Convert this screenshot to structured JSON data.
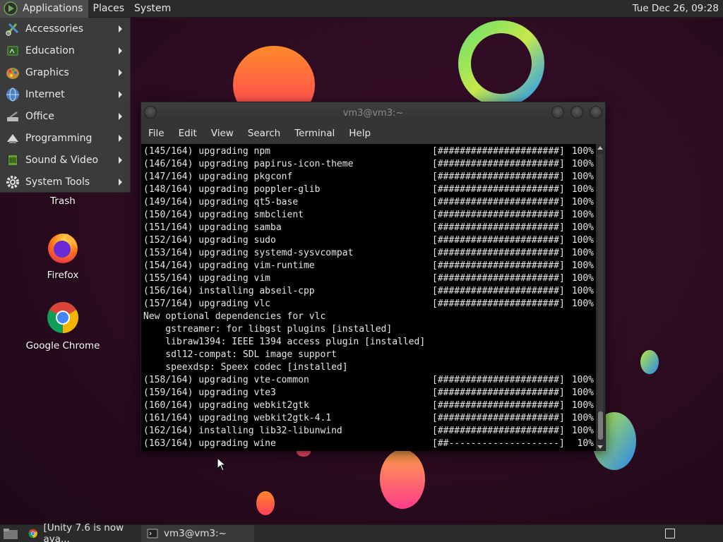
{
  "top_panel": {
    "menus": [
      "Applications",
      "Places",
      "System"
    ],
    "clock": "Tue Dec 26, 09:28"
  },
  "applications_menu": {
    "items": [
      {
        "label": "Accessories",
        "icon": "accessories-icon"
      },
      {
        "label": "Education",
        "icon": "education-icon"
      },
      {
        "label": "Graphics",
        "icon": "graphics-icon"
      },
      {
        "label": "Internet",
        "icon": "internet-icon"
      },
      {
        "label": "Office",
        "icon": "office-icon"
      },
      {
        "label": "Programming",
        "icon": "programming-icon"
      },
      {
        "label": "Sound & Video",
        "icon": "sound-video-icon"
      },
      {
        "label": "System Tools",
        "icon": "system-tools-icon"
      }
    ]
  },
  "desktop_icons": [
    {
      "label": "Trash",
      "icon": "trash-icon"
    },
    {
      "label": "Firefox",
      "icon": "firefox-icon"
    },
    {
      "label": "Google Chrome",
      "icon": "chrome-icon"
    }
  ],
  "terminal": {
    "title": "vm3@vm3:~",
    "menus": [
      "File",
      "Edit",
      "View",
      "Search",
      "Terminal",
      "Help"
    ],
    "lines": [
      {
        "text": "(145/164) upgrading npm",
        "bar": "[######################]",
        "pct": "100%"
      },
      {
        "text": "(146/164) upgrading papirus-icon-theme",
        "bar": "[######################]",
        "pct": "100%"
      },
      {
        "text": "(147/164) upgrading pkgconf",
        "bar": "[######################]",
        "pct": "100%"
      },
      {
        "text": "(148/164) upgrading poppler-glib",
        "bar": "[######################]",
        "pct": "100%"
      },
      {
        "text": "(149/164) upgrading qt5-base",
        "bar": "[######################]",
        "pct": "100%"
      },
      {
        "text": "(150/164) upgrading smbclient",
        "bar": "[######################]",
        "pct": "100%"
      },
      {
        "text": "(151/164) upgrading samba",
        "bar": "[######################]",
        "pct": "100%"
      },
      {
        "text": "(152/164) upgrading sudo",
        "bar": "[######################]",
        "pct": "100%"
      },
      {
        "text": "(153/164) upgrading systemd-sysvcompat",
        "bar": "[######################]",
        "pct": "100%"
      },
      {
        "text": "(154/164) upgrading vim-runtime",
        "bar": "[######################]",
        "pct": "100%"
      },
      {
        "text": "(155/164) upgrading vim",
        "bar": "[######################]",
        "pct": "100%"
      },
      {
        "text": "(156/164) installing abseil-cpp",
        "bar": "[######################]",
        "pct": "100%"
      },
      {
        "text": "(157/164) upgrading vlc",
        "bar": "[######################]",
        "pct": "100%"
      },
      {
        "text": "New optional dependencies for vlc",
        "bar": "",
        "pct": ""
      },
      {
        "text": "    gstreamer: for libgst plugins [installed]",
        "bar": "",
        "pct": ""
      },
      {
        "text": "    libraw1394: IEEE 1394 access plugin [installed]",
        "bar": "",
        "pct": ""
      },
      {
        "text": "    sdl12-compat: SDL image support",
        "bar": "",
        "pct": ""
      },
      {
        "text": "    speexdsp: Speex codec [installed]",
        "bar": "",
        "pct": ""
      },
      {
        "text": "(158/164) upgrading vte-common",
        "bar": "[######################]",
        "pct": "100%"
      },
      {
        "text": "(159/164) upgrading vte3",
        "bar": "[######################]",
        "pct": "100%"
      },
      {
        "text": "(160/164) upgrading webkit2gtk",
        "bar": "[######################]",
        "pct": "100%"
      },
      {
        "text": "(161/164) upgrading webkit2gtk-4.1",
        "bar": "[######################]",
        "pct": "100%"
      },
      {
        "text": "(162/164) installing lib32-libunwind",
        "bar": "[######################]",
        "pct": "100%"
      },
      {
        "text": "(163/164) upgrading wine",
        "bar": "[##--------------------]",
        "pct": "10%"
      }
    ]
  },
  "taskbar": {
    "tasks": [
      {
        "label": "[Unity 7.6 is now ava...",
        "icon": "chrome-icon"
      },
      {
        "label": "vm3@vm3:~",
        "icon": "terminal-icon"
      }
    ]
  }
}
